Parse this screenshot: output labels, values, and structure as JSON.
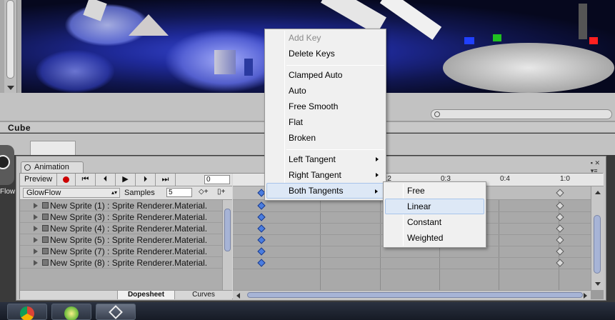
{
  "scene": {
    "object_name": "Cube",
    "flow_label": "Flow"
  },
  "animation": {
    "tab_label": "Animation",
    "preview_label": "Preview",
    "frame_value": "0",
    "clip_name": "GlowFlow",
    "samples_label": "Samples",
    "samples_value": "5",
    "tracks": [
      "New Sprite (1) : Sprite Renderer.Material.",
      "New Sprite (3) : Sprite Renderer.Material.",
      "New Sprite (4) : Sprite Renderer.Material.",
      "New Sprite (5) : Sprite Renderer.Material.",
      "New Sprite (7) : Sprite Renderer.Material.",
      "New Sprite (8) : Sprite Renderer.Material."
    ],
    "ruler_labels": [
      "0:2",
      "0:3",
      "0:4",
      "1:0"
    ],
    "modes": [
      "Dopesheet",
      "Curves"
    ],
    "selected_mode": "Dopesheet"
  },
  "context_menu": {
    "items": [
      {
        "label": "Add Key",
        "enabled": false
      },
      {
        "label": "Delete Keys",
        "enabled": true
      },
      {
        "label": "Clamped Auto",
        "enabled": true
      },
      {
        "label": "Auto",
        "enabled": true
      },
      {
        "label": "Free Smooth",
        "enabled": true
      },
      {
        "label": "Flat",
        "enabled": true
      },
      {
        "label": "Broken",
        "enabled": true
      },
      {
        "label": "Left Tangent",
        "enabled": true,
        "submenu": true
      },
      {
        "label": "Right Tangent",
        "enabled": true,
        "submenu": true
      },
      {
        "label": "Both Tangents",
        "enabled": true,
        "submenu": true,
        "highlighted": true
      }
    ]
  },
  "submenu": {
    "items": [
      "Free",
      "Linear",
      "Constant",
      "Weighted"
    ],
    "highlighted": "Linear"
  },
  "colors": {
    "keyframe_selected": "#4a7de0",
    "keyframe_unselected": "#dadada",
    "menu_highlight": "#dde8f6"
  },
  "taskbar": {
    "apps": [
      "chrome-icon",
      "app-icon",
      "unity-icon"
    ]
  }
}
